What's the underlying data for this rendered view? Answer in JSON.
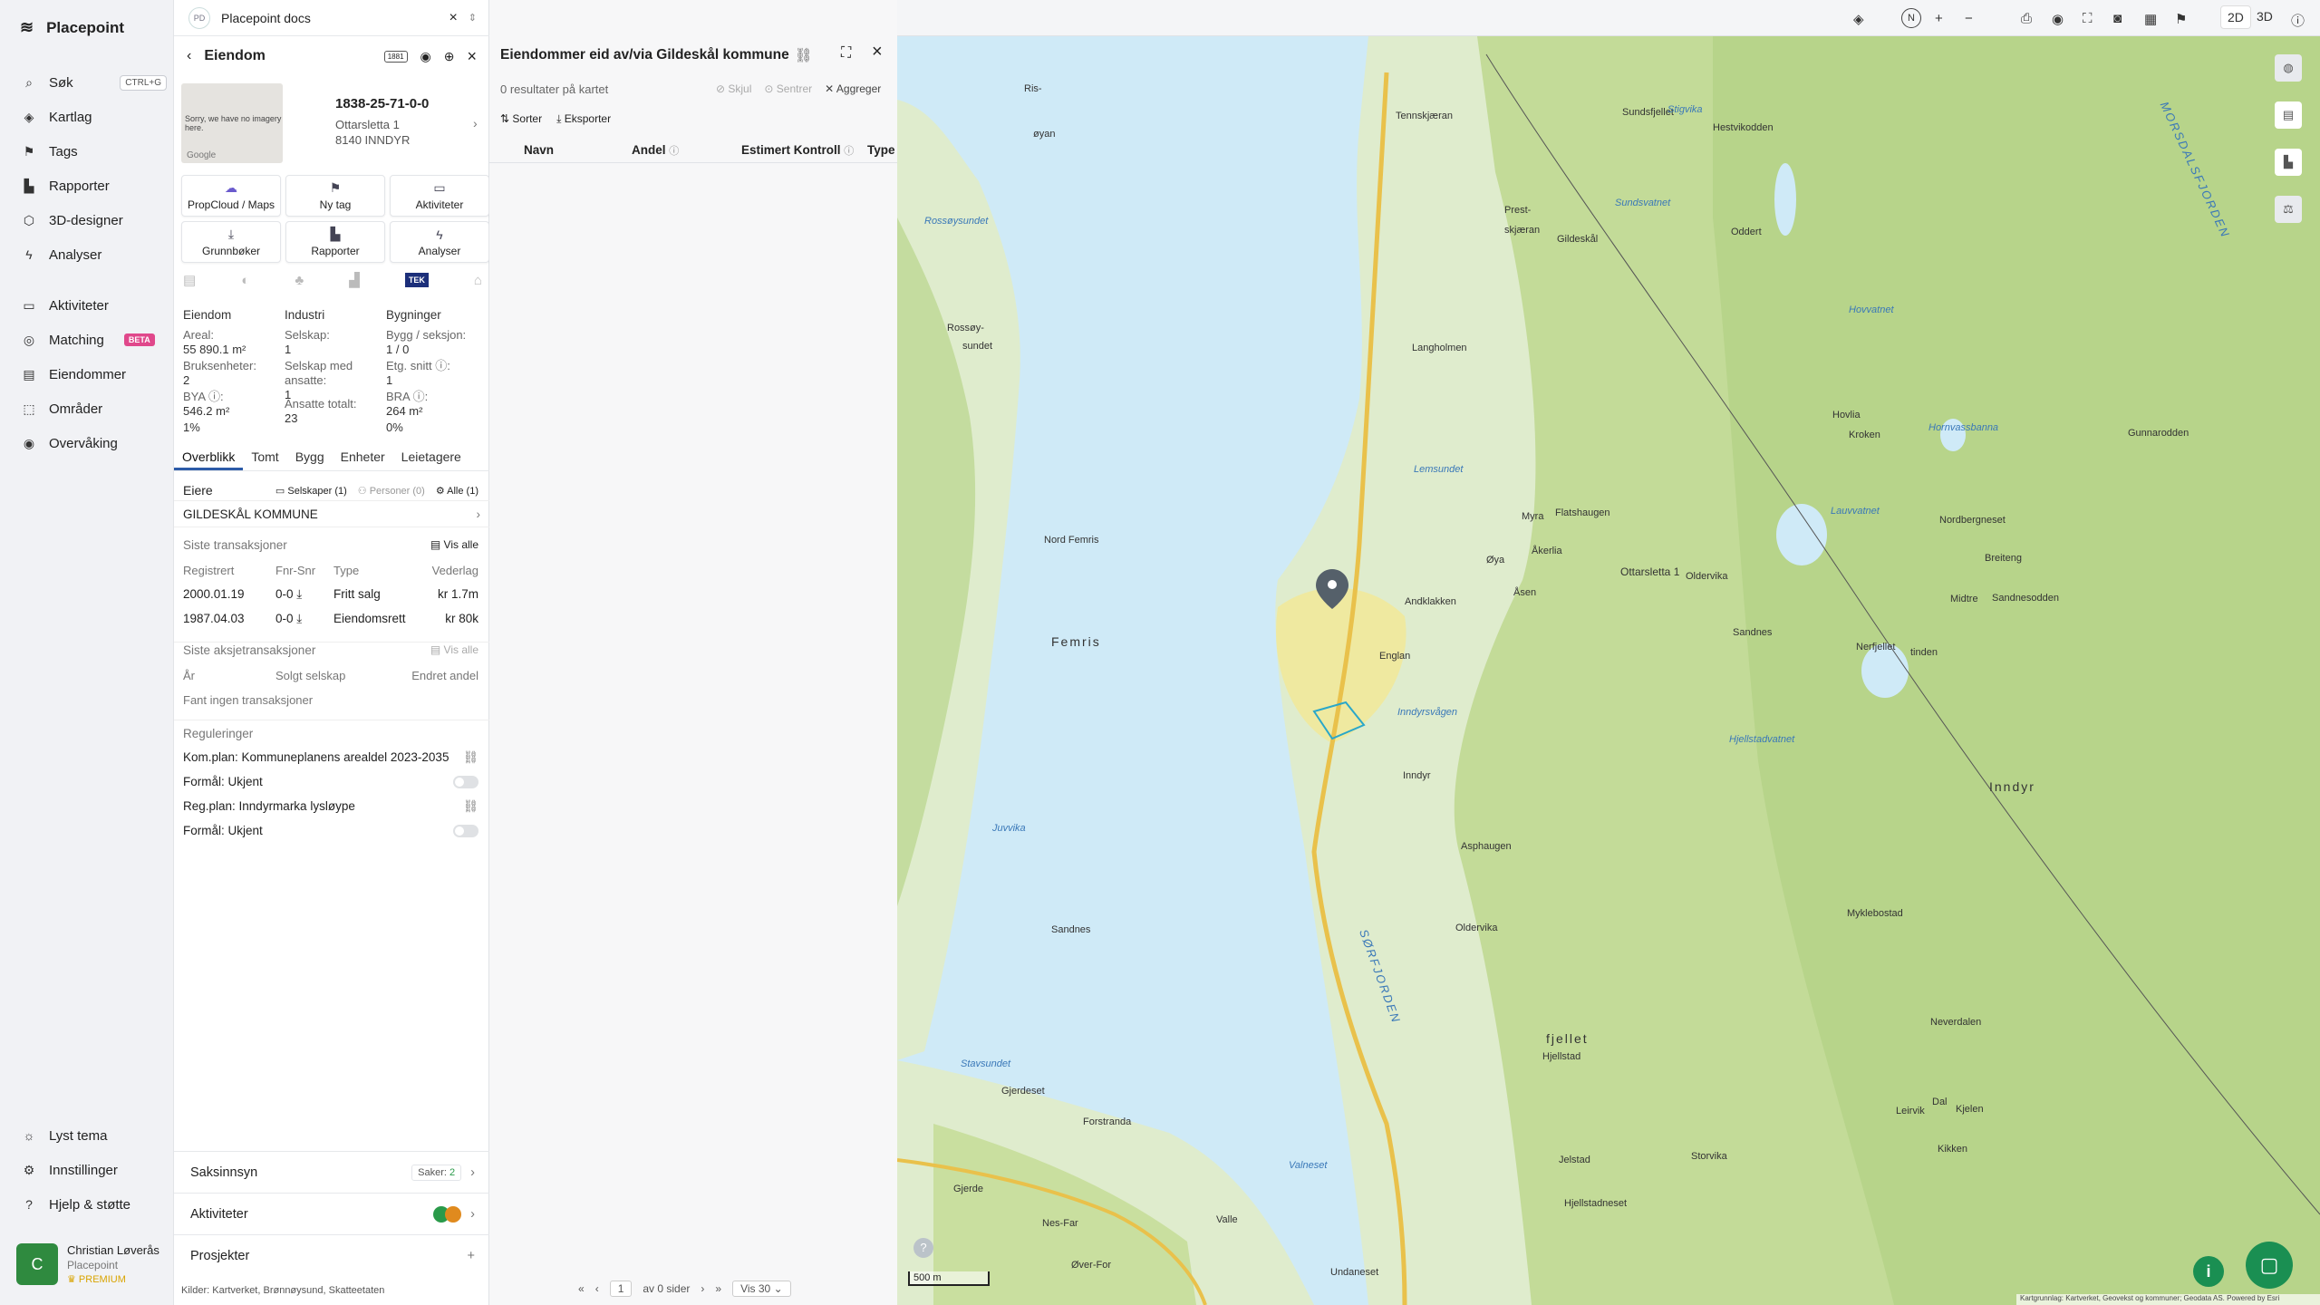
{
  "app": {
    "name": "Placepoint"
  },
  "nav": {
    "items": [
      {
        "label": "Søk",
        "kbd": "CTRL+G",
        "icon": "search-icon"
      },
      {
        "label": "Kartlag",
        "icon": "layers-icon"
      },
      {
        "label": "Tags",
        "icon": "bookmark-icon"
      },
      {
        "label": "Rapporter",
        "icon": "chart-icon"
      },
      {
        "label": "3D-designer",
        "icon": "cube-icon"
      },
      {
        "label": "Analyser",
        "icon": "bolt-icon"
      },
      {
        "label": "Aktiviteter",
        "icon": "chat-icon"
      },
      {
        "label": "Matching",
        "badge": "BETA",
        "icon": "target-icon"
      },
      {
        "label": "Eiendommer",
        "icon": "grid-icon"
      },
      {
        "label": "Områder",
        "icon": "area-icon"
      },
      {
        "label": "Overvåking",
        "icon": "watch-icon"
      }
    ],
    "bottom": [
      {
        "label": "Lyst tema",
        "icon": "sun-icon"
      },
      {
        "label": "Innstillinger",
        "icon": "gear-icon"
      },
      {
        "label": "Hjelp & støtte",
        "icon": "help-icon"
      }
    ],
    "user": {
      "initial": "C",
      "name": "Christian Løverås",
      "org": "Placepoint",
      "plan": "PREMIUM"
    }
  },
  "doc_tab": {
    "badge": "PD",
    "title": "Placepoint docs"
  },
  "property": {
    "header": "Eiendom",
    "header_badge": "1881",
    "image_text": "Sorry, we have no imagery here.",
    "image_brand": "Google",
    "id": "1838-25-71-0-0",
    "address": "Ottarsletta 1",
    "postal": "8140 INNDYR",
    "buttons": [
      "PropCloud / Maps",
      "Ny tag",
      "Aktiviteter",
      "Grunnbøker",
      "Rapporter",
      "Analyser"
    ],
    "source_badge": "TEK",
    "cols": [
      {
        "title": "Eiendom",
        "fields": [
          [
            "Areal:",
            "55 890.1 m²"
          ],
          [
            "Bruksenheter:",
            "2"
          ],
          [
            "BYA ⓘ:",
            "546.2 m²"
          ],
          [
            "",
            "1%"
          ]
        ]
      },
      {
        "title": "Industri",
        "fields": [
          [
            "Selskap:",
            "1"
          ],
          [
            "Selskap med ansatte:",
            "1"
          ],
          [
            "Ansatte totalt:",
            "23"
          ]
        ]
      },
      {
        "title": "Bygninger",
        "fields": [
          [
            "Bygg / seksjon:",
            "1 / 0"
          ],
          [
            "Etg. snitt ⓘ:",
            "1"
          ],
          [
            "BRA ⓘ:",
            "264 m²"
          ],
          [
            "",
            "0%"
          ]
        ]
      }
    ],
    "tabs": [
      "Overblikk",
      "Tomt",
      "Bygg",
      "Enheter",
      "Leietagere"
    ],
    "owners": {
      "label": "Eiere",
      "filters": [
        "Selskaper (1)",
        "Personer (0)",
        "Alle (1)"
      ],
      "name": "GILDESKÅL KOMMUNE"
    },
    "transactions": {
      "title": "Siste transaksjoner",
      "view_all": "Vis alle",
      "headers": [
        "Registrert",
        "Fnr-Snr",
        "Type",
        "Vederlag"
      ],
      "rows": [
        [
          "2000.01.19",
          "0-0",
          "Fritt salg",
          "kr 1.7m"
        ],
        [
          "1987.04.03",
          "0-0",
          "Eiendomsrett",
          "kr 80k"
        ]
      ]
    },
    "share_tx": {
      "title": "Siste aksjetransaksjoner",
      "view_all": "Vis alle",
      "headers": [
        "År",
        "Solgt selskap",
        "Endret andel"
      ],
      "empty": "Fant ingen transaksjoner"
    },
    "regulations": {
      "title": "Reguleringer",
      "items": [
        [
          "Kom.plan: Kommuneplanens arealdel 2023-2035",
          "Formål: Ukjent"
        ],
        [
          "Reg.plan: Inndyrmarka lysløype",
          "Formål: Ukjent"
        ]
      ]
    },
    "sections": [
      {
        "label": "Saksinnsyn",
        "meta": "Saker:",
        "count": "2"
      },
      {
        "label": "Aktiviteter"
      },
      {
        "label": "Prosjekter"
      }
    ],
    "sources": "Kilder:  Kartverket,  Brønnøysund,  Skatteetaten"
  },
  "results": {
    "title": "Eiendommer eid av/via Gildeskål kommune",
    "count": "0 resultater på kartet",
    "actions": [
      "Skjul",
      "Sentrer",
      "Aggreger"
    ],
    "tools": [
      "Sorter",
      "Eksporter"
    ],
    "columns": [
      "Navn",
      "Andel",
      "Estimert Kontroll",
      "Type"
    ],
    "pager": {
      "page": "1",
      "of": "av 0 sider",
      "per": "Vis 30"
    }
  },
  "map": {
    "view_modes": [
      "2D",
      "3D"
    ],
    "scale": "500 m",
    "attribution": "Kartgrunnlag: Kartverket, Geovekst og kommuner; Geodata AS. Powered by Esri",
    "labels": [
      {
        "t": "Ris-",
        "w": false
      },
      {
        "t": "øyan",
        "w": false
      },
      {
        "t": "Rossøysundet",
        "w": true
      },
      {
        "t": "Rossøy-",
        "w": false
      },
      {
        "t": "sundet",
        "w": false
      },
      {
        "t": "Nord Femris",
        "w": false
      },
      {
        "t": "Femris",
        "w": false
      },
      {
        "t": "Sandnes",
        "w": false
      },
      {
        "t": "Juvvika",
        "w": true
      },
      {
        "t": "Stavsundet",
        "w": true
      },
      {
        "t": "Gjerdeset",
        "w": false
      },
      {
        "t": "Forstranda",
        "w": false
      },
      {
        "t": "Gjerde",
        "w": false
      },
      {
        "t": "Nes-Far",
        "w": false
      },
      {
        "t": "Øver-For",
        "w": false
      },
      {
        "t": "Valle",
        "w": false
      },
      {
        "t": "Valneset",
        "w": true
      },
      {
        "t": "Undaneset",
        "w": false
      },
      {
        "t": "SØRFJORDEN",
        "w": true
      },
      {
        "t": "Tennskjæran",
        "w": false
      },
      {
        "t": "Prest-",
        "w": false
      },
      {
        "t": "skjæran",
        "w": false
      },
      {
        "t": "Langholmen",
        "w": false
      },
      {
        "t": "Lemsundet",
        "w": true
      },
      {
        "t": "Andklakken",
        "w": false
      },
      {
        "t": "Englan",
        "w": false
      },
      {
        "t": "Inndyrsvågen",
        "w": true
      },
      {
        "t": "Inndyr",
        "w": false
      },
      {
        "t": "Asphaugen",
        "w": false
      },
      {
        "t": "Oldervika",
        "w": false
      },
      {
        "t": "Myra",
        "w": false
      },
      {
        "t": "Øya",
        "w": false
      },
      {
        "t": "Flatshaugen",
        "w": false
      },
      {
        "t": "Åkerlia",
        "w": false
      },
      {
        "t": "Åsen",
        "w": false
      },
      {
        "t": "Gildeskål",
        "w": false
      },
      {
        "t": "Sundsfjellet",
        "w": false
      },
      {
        "t": "Hestvikodden",
        "w": false
      },
      {
        "t": "Sundsvatnet",
        "w": true
      },
      {
        "t": "Stigvika",
        "w": true
      },
      {
        "t": "Oddert",
        "w": false
      },
      {
        "t": "MORSDALSFJORDEN",
        "w": true
      },
      {
        "t": "Hovvatnet",
        "w": true
      },
      {
        "t": "Hovlia",
        "w": false
      },
      {
        "t": "Kroken",
        "w": false
      },
      {
        "t": "Hornvassbanna",
        "w": true
      },
      {
        "t": "Gunnarodden",
        "w": false
      },
      {
        "t": "Nordbergneset",
        "w": false
      },
      {
        "t": "Lauvvatnet",
        "w": true
      },
      {
        "t": "Breiteng",
        "w": false
      },
      {
        "t": "Sandnesodden",
        "w": false
      },
      {
        "t": "Midtre",
        "w": false
      },
      {
        "t": "Sandnes",
        "w": false
      },
      {
        "t": "Nerfjellet",
        "w": false
      },
      {
        "t": "tinden",
        "w": false
      },
      {
        "t": "Hjellstadvatnet",
        "w": true
      },
      {
        "t": "Inndyr",
        "w": false
      },
      {
        "t": "Myklebostad",
        "w": false
      },
      {
        "t": "Neverdalen",
        "w": false
      },
      {
        "t": "fjellet",
        "w": false
      },
      {
        "t": "Hjellstad",
        "w": false
      },
      {
        "t": "Jelstad",
        "w": false
      },
      {
        "t": "Hjellstadneset",
        "w": false
      },
      {
        "t": "Storvika",
        "w": false
      },
      {
        "t": "Dal",
        "w": false
      },
      {
        "t": "Kjelen",
        "w": false
      },
      {
        "t": "Leirvik",
        "w": false
      },
      {
        "t": "Kikken",
        "w": false
      },
      {
        "t": "Ottarsletta 1",
        "w": false
      },
      {
        "t": "Oldervika",
        "w": false
      }
    ]
  }
}
